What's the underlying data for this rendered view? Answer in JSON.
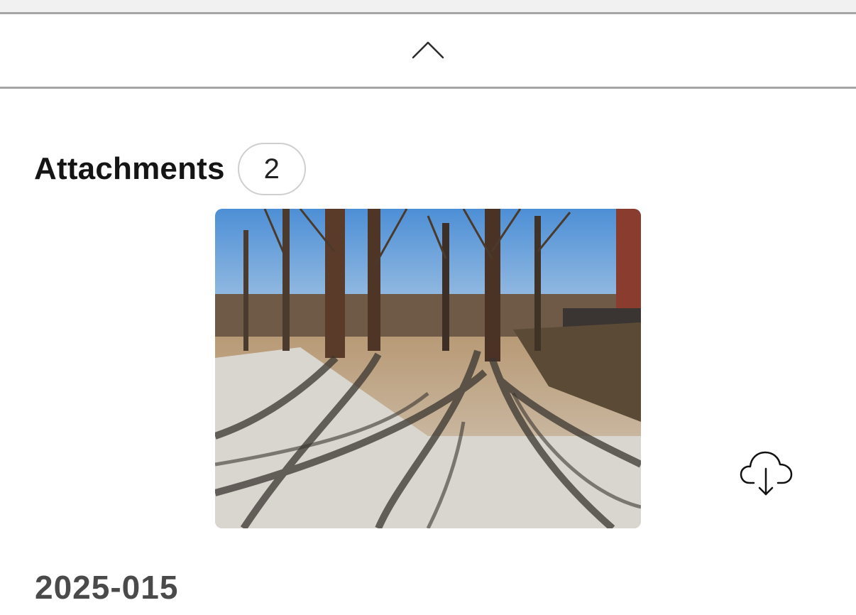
{
  "icons": {
    "collapse": "chevron-up-icon",
    "download": "cloud-download-icon"
  },
  "attachments": {
    "title": "Attachments",
    "count": "2",
    "items": [
      {
        "description": "photo-thumbnail"
      }
    ]
  },
  "record": {
    "id": "2025-015"
  },
  "colors": {
    "divider": "#a5a5a5",
    "top_strip": "#f1f1f1",
    "title_text": "#151515",
    "record_text": "#4a4a4a"
  }
}
